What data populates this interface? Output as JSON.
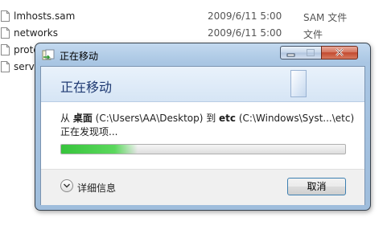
{
  "files": [
    {
      "name": "lmhosts.sam",
      "date": "2009/6/11 5:00",
      "type": "SAM 文件"
    },
    {
      "name": "networks",
      "date": "2009/6/11 5:00",
      "type": "文件"
    },
    {
      "name": "proto",
      "date": "",
      "type": ""
    },
    {
      "name": "servi",
      "date": "",
      "type": ""
    }
  ],
  "dialog": {
    "title": "正在移动",
    "header": "正在移动",
    "from_prefix": "从 ",
    "source_name": "桌面",
    "source_path": " (C:\\Users\\AA\\Desktop) 到 ",
    "dest_name": "etc",
    "dest_path": " (C:\\Windows\\Syst...\\etc)",
    "status": "正在发现项...",
    "progress": 0.27,
    "details_label": "详细信息",
    "cancel_label": "取消"
  },
  "colors": {
    "accent": "#1f3a72",
    "progress_green": "#37c43c",
    "close_red": "#c24a30"
  }
}
